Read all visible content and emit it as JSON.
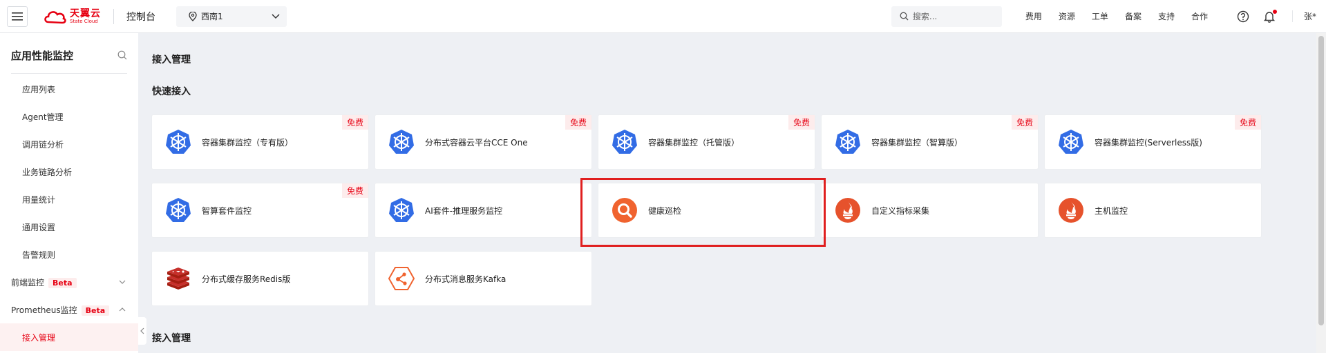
{
  "topbar": {
    "logo_cn": "天翼云",
    "logo_en": "State Cloud",
    "console_label": "控制台",
    "region": "西南1",
    "search_placeholder": "搜索...",
    "nav": [
      "费用",
      "资源",
      "工单",
      "备案",
      "支持",
      "合作"
    ],
    "user": "张*"
  },
  "sidebar": {
    "title": "应用性能监控",
    "items": [
      "应用列表",
      "Agent管理",
      "调用链分析",
      "业务链路分析",
      "用量统计",
      "通用设置",
      "告警规则"
    ],
    "groups": [
      {
        "label": "前端监控",
        "badge": "Beta"
      },
      {
        "label": "Prometheus监控",
        "badge": "Beta"
      }
    ],
    "active_item": "接入管理"
  },
  "main": {
    "page_title": "接入管理",
    "quick_title": "快速接入",
    "bottom_title": "接入管理",
    "free_badge": "免费",
    "cards": [
      {
        "label": "容器集群监控（专有版）",
        "icon": "kubernetes-icon",
        "free": true
      },
      {
        "label": "分布式容器云平台CCE One",
        "icon": "kubernetes-icon",
        "free": true
      },
      {
        "label": "容器集群监控（托管版）",
        "icon": "kubernetes-icon",
        "free": true
      },
      {
        "label": "容器集群监控（智算版）",
        "icon": "kubernetes-icon",
        "free": true
      },
      {
        "label": "容器集群监控(Serverless版)",
        "icon": "kubernetes-icon",
        "free": true
      },
      {
        "label": "智算套件监控",
        "icon": "kubernetes-icon",
        "free": true
      },
      {
        "label": "AI套件-推理服务监控",
        "icon": "kubernetes-icon",
        "free": false
      },
      {
        "label": "健康巡检",
        "icon": "health-check-icon",
        "free": false
      },
      {
        "label": "自定义指标采集",
        "icon": "prometheus-icon",
        "free": false
      },
      {
        "label": "主机监控",
        "icon": "prometheus-icon",
        "free": false
      },
      {
        "label": "分布式缓存服务Redis版",
        "icon": "redis-icon",
        "free": false
      },
      {
        "label": "分布式消息服务Kafka",
        "icon": "kafka-icon",
        "free": false
      }
    ]
  },
  "colors": {
    "brand_red": "#e60012",
    "kubernetes_blue": "#326ce5",
    "prometheus_orange": "#e6522c",
    "highlight_red": "#e01f1f"
  }
}
